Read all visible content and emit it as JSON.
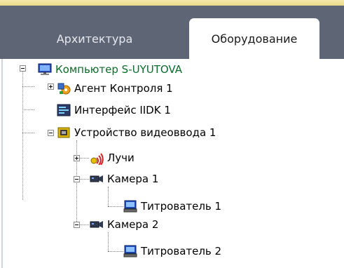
{
  "tabs": {
    "architecture": "Архитектура",
    "equipment": "Оборудование"
  },
  "tree": {
    "computer": "Компьютер S-UYUTOVA",
    "agent": "Агент Контроля 1",
    "iidk": "Интерфейс IIDK 1",
    "video_device": "Устройство видеоввода 1",
    "rays": "Лучи",
    "camera1": "Камера 1",
    "titler1": "Титрователь 1",
    "camera2": "Камера 2",
    "titler2": "Титрователь 2"
  },
  "colors": {
    "tabbar": "#5e6676",
    "computer_label": "#0b6b2a"
  }
}
